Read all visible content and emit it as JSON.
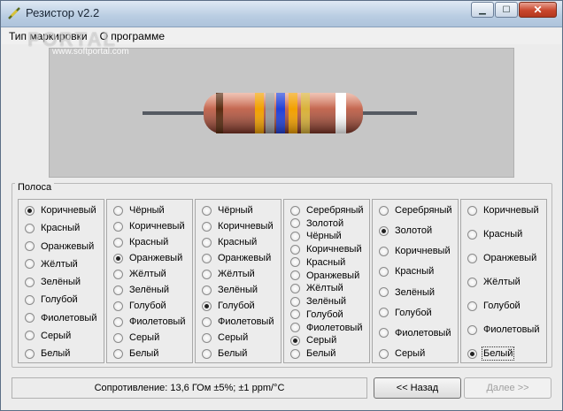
{
  "window": {
    "title": "Резистор v2.2"
  },
  "menu": {
    "items": [
      "Тип маркировки",
      "О программе"
    ]
  },
  "watermark": {
    "text": "PORTAL",
    "url": "www.softportal.com"
  },
  "resistor": {
    "bands": [
      "#5a2b10",
      "#f2a000",
      "#9a9a9a",
      "#2140d8",
      "#f2a000",
      "#d9b13a",
      "#ffffff"
    ]
  },
  "bands_group": {
    "label": "Полоса"
  },
  "columns": [
    {
      "options": [
        "Коричневый",
        "Красный",
        "Оранжевый",
        "Жёлтый",
        "Зелёный",
        "Голубой",
        "Фиолетовый",
        "Серый",
        "Белый"
      ],
      "selected": 0
    },
    {
      "options": [
        "Чёрный",
        "Коричневый",
        "Красный",
        "Оранжевый",
        "Жёлтый",
        "Зелёный",
        "Голубой",
        "Фиолетовый",
        "Серый",
        "Белый"
      ],
      "selected": 3
    },
    {
      "options": [
        "Чёрный",
        "Коричневый",
        "Красный",
        "Оранжевый",
        "Жёлтый",
        "Зелёный",
        "Голубой",
        "Фиолетовый",
        "Серый",
        "Белый"
      ],
      "selected": 6
    },
    {
      "options": [
        "Серебряный",
        "Золотой",
        "Чёрный",
        "Коричневый",
        "Красный",
        "Оранжевый",
        "Жёлтый",
        "Зелёный",
        "Голубой",
        "Фиолетовый",
        "Серый",
        "Белый"
      ],
      "selected": 10
    },
    {
      "options": [
        "Серебряный",
        "Золотой",
        "Коричневый",
        "Красный",
        "Зелёный",
        "Голубой",
        "Фиолетовый",
        "Серый"
      ],
      "selected": 1
    },
    {
      "options": [
        "Коричневый",
        "Красный",
        "Оранжевый",
        "Жёлтый",
        "Голубой",
        "Фиолетовый",
        "Белый"
      ],
      "selected": 6
    }
  ],
  "status": {
    "text": "Сопротивление: 13,6 ГОм ±5%; ±1 ppm/°C"
  },
  "buttons": {
    "back": "<< Назад",
    "next": "Далее >>"
  }
}
